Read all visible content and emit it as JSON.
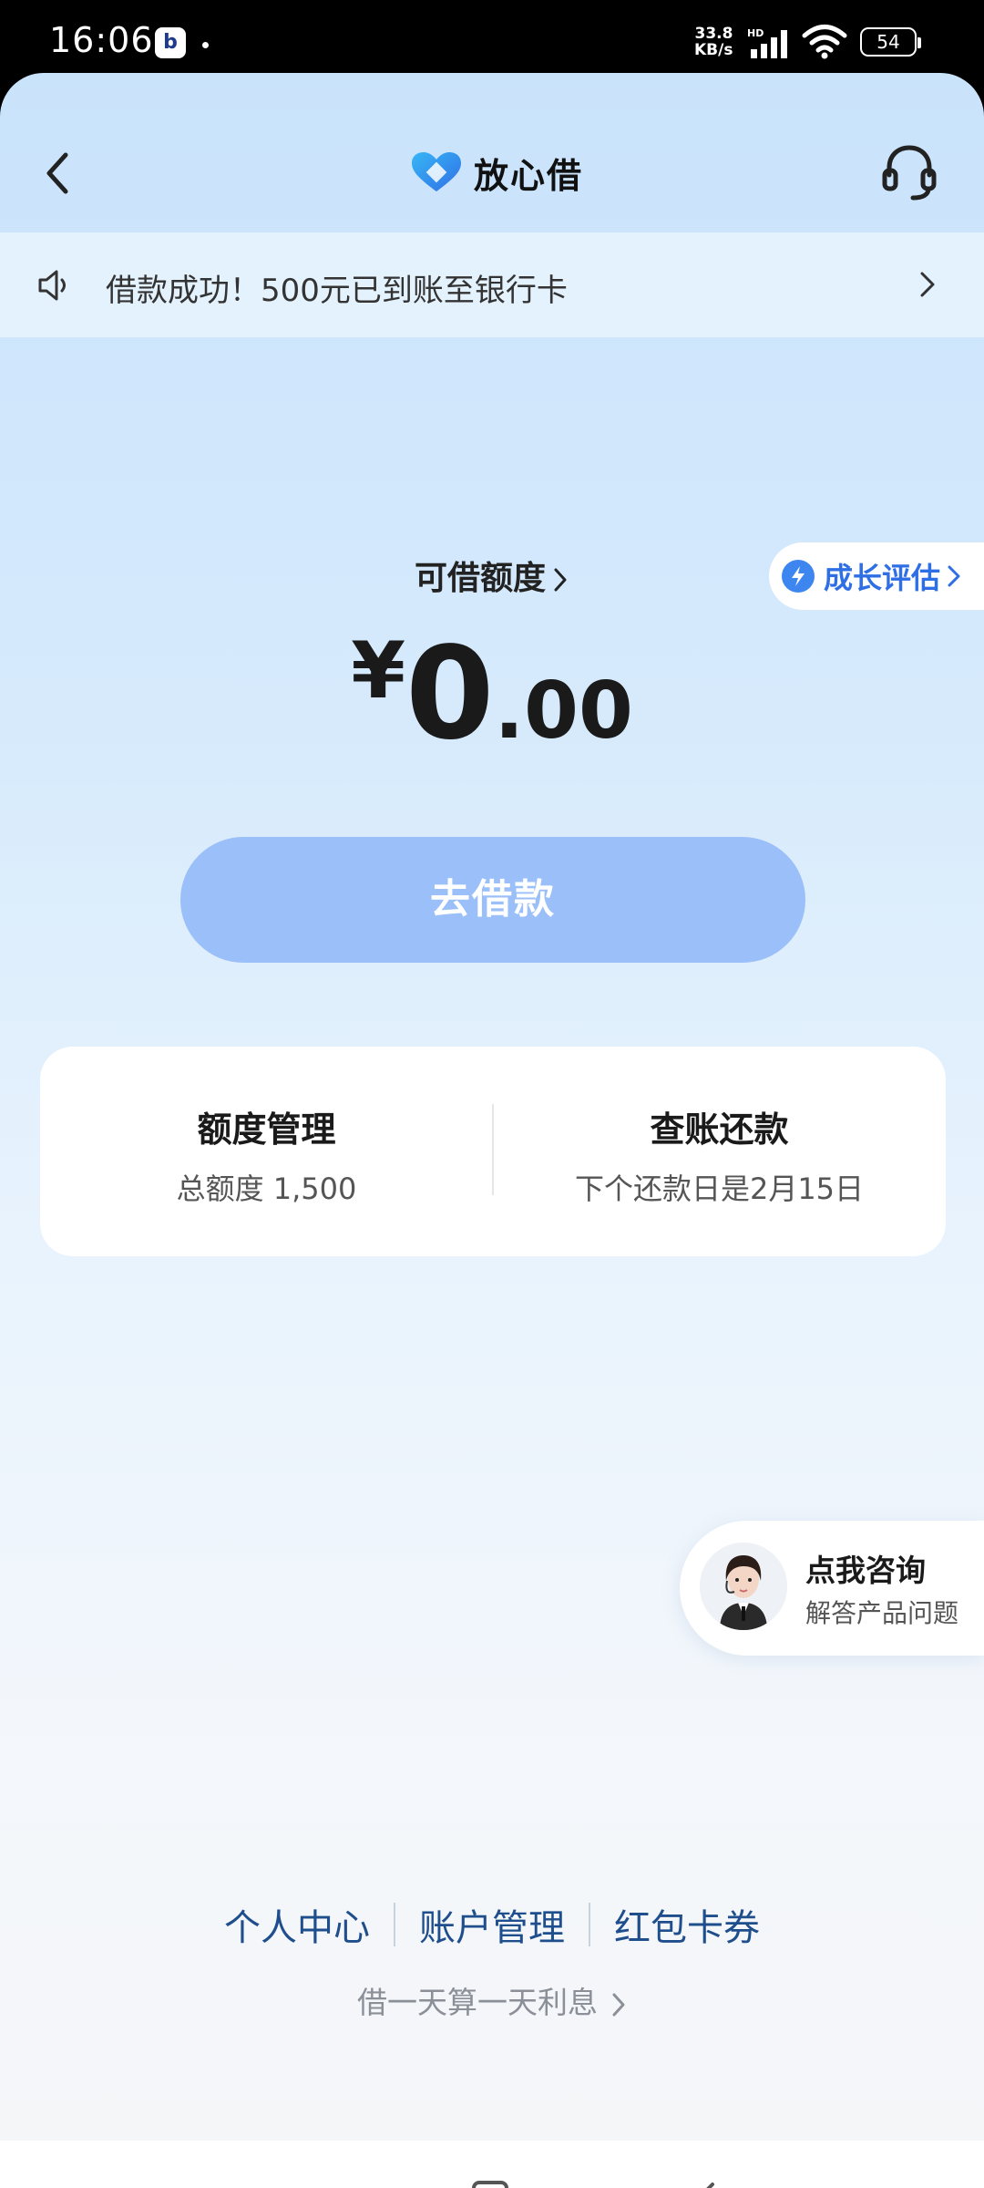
{
  "status_bar": {
    "time": "16:06",
    "net_speed_value": "33.8",
    "net_speed_unit": "KB/s",
    "net_type": "HD",
    "battery": "54"
  },
  "header": {
    "title": "放心借",
    "back_icon": "chevron-left-icon",
    "support_icon": "headset-icon"
  },
  "notice": {
    "text": "借款成功！500元已到账至银行卡",
    "icon": "speaker-icon"
  },
  "growth_badge": {
    "label": "成长评估"
  },
  "quota": {
    "title": "可借额度",
    "currency": "¥",
    "amount_int": "0",
    "amount_dec": ".00"
  },
  "borrow_button": {
    "label": "去借款"
  },
  "card": {
    "left_title": "额度管理",
    "left_sub": "总额度 1,500",
    "right_title": "查账还款",
    "right_sub": "下个还款日是2月15日"
  },
  "consult": {
    "title": "点我咨询",
    "subtitle": "解答产品问题"
  },
  "footer_links": [
    "个人中心",
    "账户管理",
    "红包卡券"
  ],
  "tagline": "借一天算一天利息",
  "colors": {
    "accent": "#3d86f0",
    "button": "#9bbff9",
    "link": "#1f4e8c"
  }
}
